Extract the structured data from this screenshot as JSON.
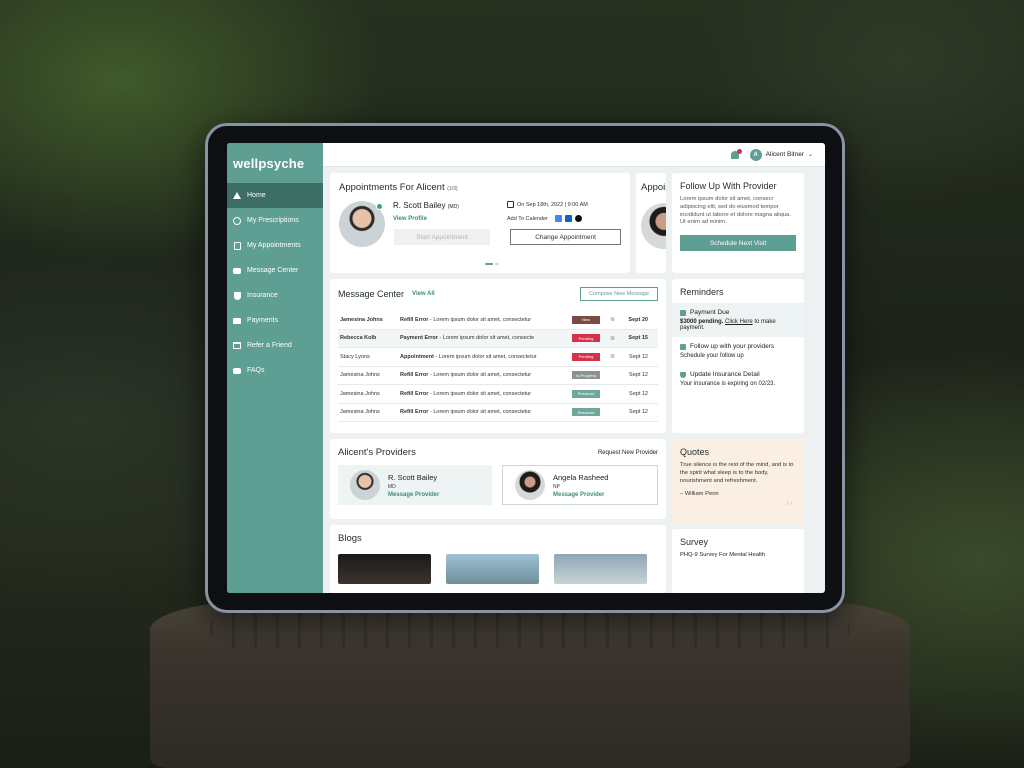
{
  "app": {
    "logo": "wellpsyche"
  },
  "sidebar": {
    "items": [
      {
        "label": "Home",
        "icon": "home-icon",
        "active": true
      },
      {
        "label": "My Prescriptions",
        "icon": "prescription-icon"
      },
      {
        "label": "My Appointments",
        "icon": "appointment-icon"
      },
      {
        "label": "Message Center",
        "icon": "message-icon"
      },
      {
        "label": "Insurance",
        "icon": "shield-icon"
      },
      {
        "label": "Payments",
        "icon": "wallet-icon"
      },
      {
        "label": "Refer a Friend",
        "icon": "gift-icon"
      },
      {
        "label": "FAQs",
        "icon": "faq-icon"
      }
    ]
  },
  "topbar": {
    "user_initial": "A",
    "user_name": "Alicent Bitner"
  },
  "appointments": {
    "title": "Appointments For Alicent",
    "count": "(1/3)",
    "peek_title": "Appoin",
    "doctor": "R. Scott Bailey",
    "doctor_cred": "(MD)",
    "view_profile": "View Profile",
    "date": "On Sep 18th,  2022 | 9:00 AM",
    "add_calendar": "Add To Calender",
    "start_btn": "Start Appointment",
    "change_btn": "Change Appointment"
  },
  "messages": {
    "title": "Message Center",
    "view_all": "View All",
    "compose": "Compose New Message",
    "rows": [
      {
        "from": "Jamesina Johns",
        "subject": "Refill Error",
        "preview": " - Lorem ipsum dolor sit amet, consectetur",
        "status": "New",
        "status_color": "#7a4b43",
        "date": "Sept 20",
        "unread": true,
        "alt": false,
        "eye": true
      },
      {
        "from": "Rebecca Kolb",
        "subject": "Payment Error",
        "preview": " - Lorem ipsum dolor sit amet, consecte",
        "status": "Pending",
        "status_color": "#d7304b",
        "date": "Sept 15",
        "unread": true,
        "alt": true,
        "eye": true
      },
      {
        "from": "Stacy Lyons",
        "subject": "Appointment",
        "preview": " - Lorem ipsum dolor sit amet, consectetur",
        "status": "Pending",
        "status_color": "#d7304b",
        "date": "Sept 12",
        "unread": false,
        "alt": false,
        "eye": true
      },
      {
        "from": "Jamesina Johns",
        "subject": "Refill Error",
        "preview": " - Lorem ipsum dolor sit amet, consectetur",
        "status": "In-Progress",
        "status_color": "#8a9390",
        "date": "Sept 12",
        "unread": false,
        "alt": false,
        "eye": false
      },
      {
        "from": "Jamesina Johns",
        "subject": "Refill Error",
        "preview": " - Lorem ipsum dolor sit amet, consectetur",
        "status": "Resolved",
        "status_color": "#6ea89d",
        "date": "Sept 12",
        "unread": false,
        "alt": false,
        "eye": false
      },
      {
        "from": "Jamesina Johns",
        "subject": "Refill Error",
        "preview": " - Lorem ipsum dolor sit amet, consectetur",
        "status": "Resolved",
        "status_color": "#6ea89d",
        "date": "Sept 12",
        "unread": false,
        "alt": false,
        "eye": false
      }
    ]
  },
  "providers": {
    "title": "Alicent's Providers",
    "request": "Request New Provider",
    "items": [
      {
        "name": "R. Scott Bailey",
        "title": "MD",
        "link": "Message Provider"
      },
      {
        "name": "Angela Rasheed",
        "title": "NP",
        "link": "Message Provider"
      }
    ]
  },
  "blogs": {
    "title": "Blogs"
  },
  "followup": {
    "title": "Follow Up With Provider",
    "text": "Lorem ipsum dolor sit amet, consecr adipiscing elit, sed do eiusmod tempor incididunt ut labore et dolore magna aliqua. Ut enim ad minim.",
    "button": "Schedule Next Visit"
  },
  "reminders": {
    "title": "Reminders",
    "payment_title": "Payment Due",
    "payment_text_a": "$3000 pending. ",
    "payment_link": "Click Here",
    "payment_text_b": " to make payment.",
    "followup_title": "Follow up with your providers",
    "followup_text": "Schedule your follow up",
    "insurance_title": "Update Insurance Detail",
    "insurance_text": "Your insurance is expiring on 02/23."
  },
  "quotes": {
    "title": "Quotes",
    "text": "True silence is the rest of the mind, and is to the spirit what sleep is to the body, nourishment and refreshment.",
    "author": "– William Penn"
  },
  "survey": {
    "title": "Survey",
    "item": "PHQ-9 Survey For Mental Health"
  },
  "colors": {
    "brand": "#5f9e92",
    "brand_dark": "#3d6e66",
    "alert": "#d7304b"
  }
}
